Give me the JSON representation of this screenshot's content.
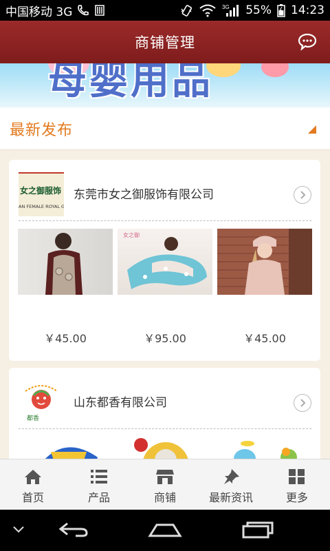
{
  "status_bar": {
    "carrier": "中国移动 3G",
    "battery": "55%",
    "time": "14:23",
    "icons": [
      "phone-icon",
      "storage-icon",
      "vibrate-icon",
      "wifi-icon",
      "signal-icon",
      "battery-icon"
    ]
  },
  "header": {
    "title": "商铺管理",
    "action_icon": "chat-bubble-icon"
  },
  "banner": {
    "text": "母婴用品"
  },
  "section": {
    "title": "最新发布"
  },
  "cards": [
    {
      "company": "东莞市女之御服饰有限公司",
      "logo_text": "女之御服饰",
      "logo_subtext": "AN FEMALE ROYAL GA",
      "products": [
        {
          "price": "￥45.00"
        },
        {
          "price": "￥95.00"
        },
        {
          "price": "￥45.00"
        }
      ]
    },
    {
      "company": "山东都香有限公司",
      "logo_text": "都香",
      "products": []
    }
  ],
  "bottom_nav": [
    {
      "label": "首页",
      "icon": "home-icon"
    },
    {
      "label": "产品",
      "icon": "list-icon"
    },
    {
      "label": "商铺",
      "icon": "shop-icon"
    },
    {
      "label": "最新资讯",
      "icon": "pin-icon"
    },
    {
      "label": "更多",
      "icon": "grid-icon"
    }
  ],
  "colors": {
    "header_bg": "#8b2323",
    "accent": "#e27a1f",
    "page_bg": "#f6efe3"
  }
}
